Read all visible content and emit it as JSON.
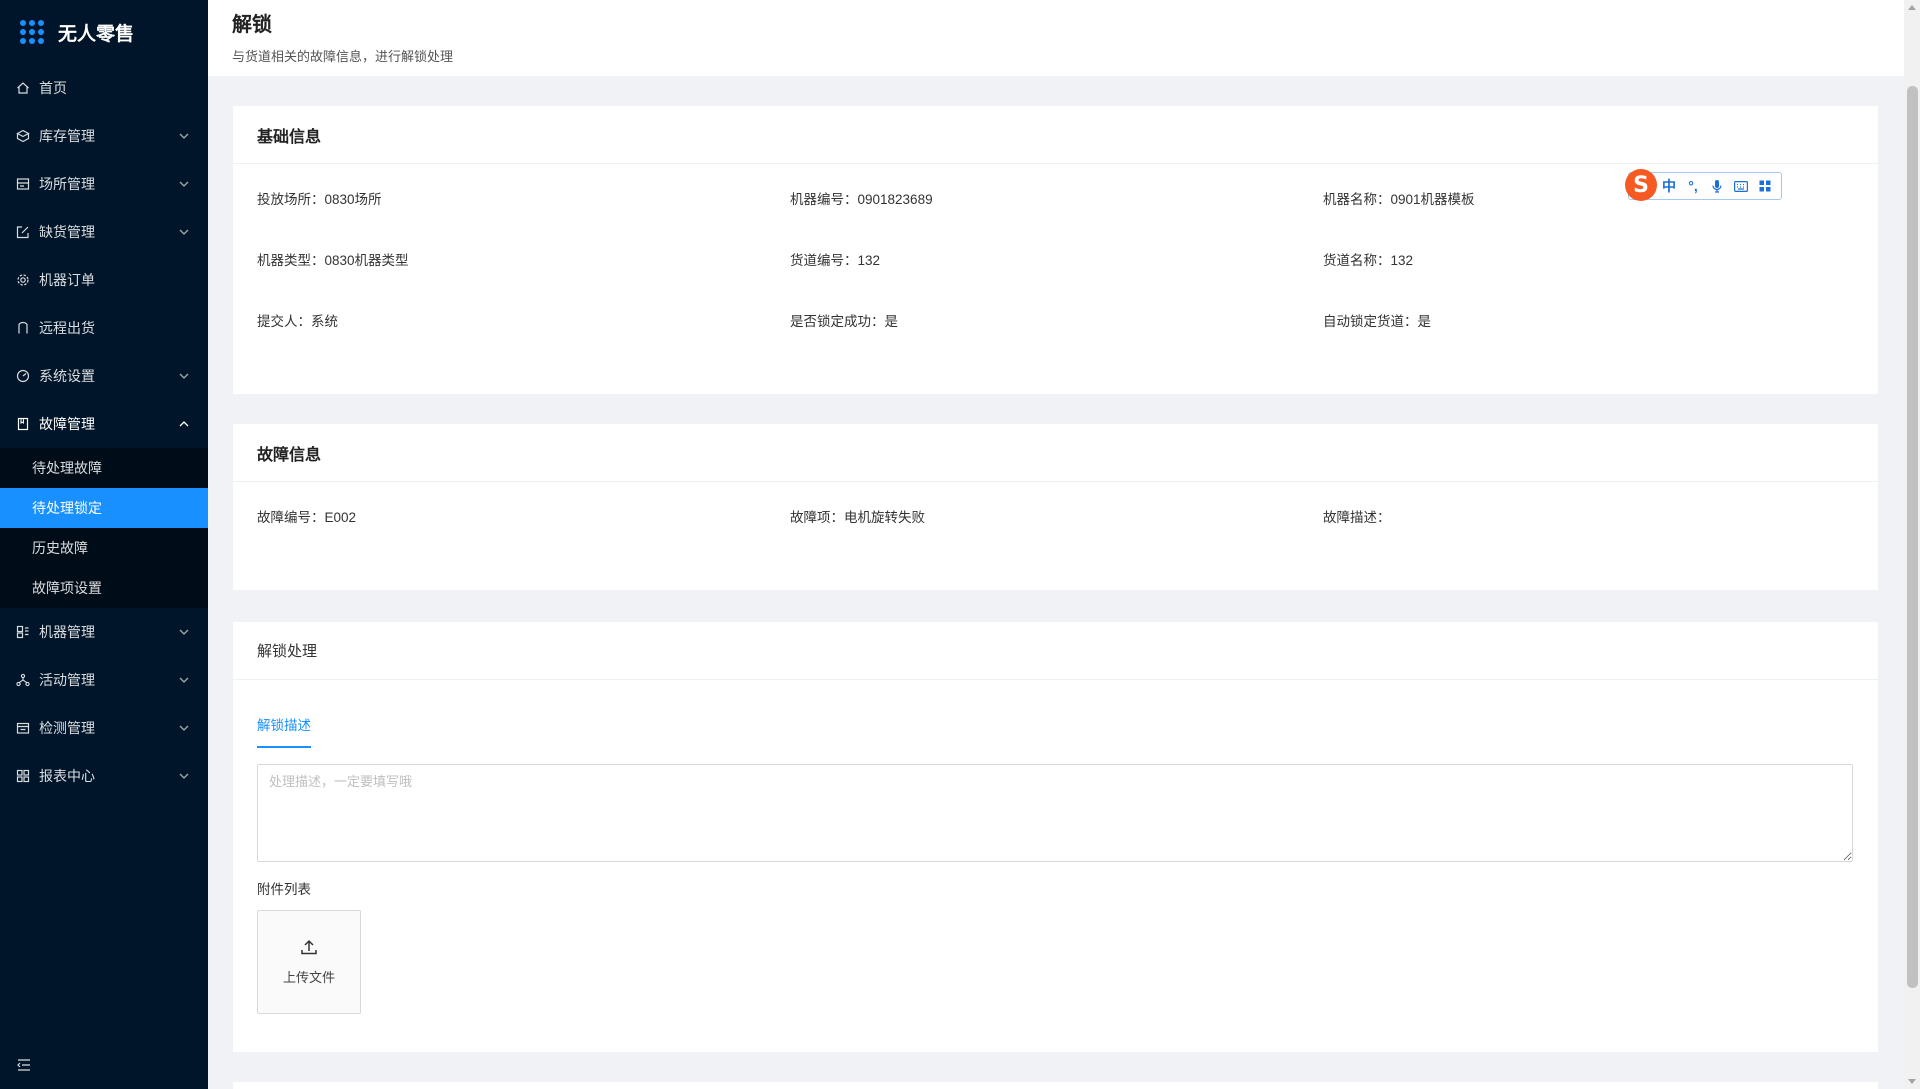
{
  "app": {
    "title": "无人零售"
  },
  "sidebar": {
    "items": [
      {
        "label": "首页",
        "icon": "home-icon",
        "has_children": false
      },
      {
        "label": "库存管理",
        "icon": "cube-icon",
        "has_children": true
      },
      {
        "label": "场所管理",
        "icon": "store-icon",
        "has_children": true
      },
      {
        "label": "缺货管理",
        "icon": "edit-icon",
        "has_children": true
      },
      {
        "label": "机器订单",
        "icon": "settings-icon",
        "has_children": false
      },
      {
        "label": "远程出货",
        "icon": "user-icon",
        "has_children": false
      },
      {
        "label": "系统设置",
        "icon": "dashboard-icon",
        "has_children": true
      },
      {
        "label": "故障管理",
        "icon": "book-icon",
        "has_children": true,
        "expanded": true,
        "children": [
          {
            "label": "待处理故障"
          },
          {
            "label": "待处理锁定",
            "active": true
          },
          {
            "label": "历史故障"
          },
          {
            "label": "故障项设置"
          }
        ]
      },
      {
        "label": "机器管理",
        "icon": "machine-icon",
        "has_children": true
      },
      {
        "label": "活动管理",
        "icon": "branch-icon",
        "has_children": true
      },
      {
        "label": "检测管理",
        "icon": "calendar-icon",
        "has_children": true
      },
      {
        "label": "报表中心",
        "icon": "grid-icon",
        "has_children": true
      }
    ]
  },
  "page": {
    "title": "解锁",
    "description": "与货道相关的故障信息，进行解锁处理"
  },
  "basic_info": {
    "title": "基础信息",
    "fields": [
      {
        "label": "投放场所：",
        "value": "0830场所"
      },
      {
        "label": "机器编号：",
        "value": "0901823689"
      },
      {
        "label": "机器名称：",
        "value": "0901机器模板"
      },
      {
        "label": "机器类型：",
        "value": "0830机器类型"
      },
      {
        "label": "货道编号：",
        "value": "132"
      },
      {
        "label": "货道名称：",
        "value": "132"
      },
      {
        "label": "提交人：",
        "value": "系统"
      },
      {
        "label": "是否锁定成功：",
        "value": "是"
      },
      {
        "label": "自动锁定货道：",
        "value": "是"
      }
    ]
  },
  "fault_info": {
    "title": "故障信息",
    "fields": [
      {
        "label": "故障编号：",
        "value": "E002"
      },
      {
        "label": "故障项：",
        "value": "电机旋转失败"
      },
      {
        "label": "故障描述：",
        "value": ""
      }
    ]
  },
  "unlock": {
    "title": "解锁处理",
    "tab_label": "解锁描述",
    "textarea_placeholder": "处理描述，一定要填写哦",
    "textarea_value": "",
    "attach_label": "附件列表",
    "upload_label": "上传文件"
  },
  "ime": {
    "logo": "S",
    "mode": "中",
    "punct": "°,"
  },
  "colors": {
    "sidebar_bg": "#001529",
    "submenu_bg": "#000c17",
    "accent": "#1890ff",
    "page_bg": "#f0f2f5"
  }
}
